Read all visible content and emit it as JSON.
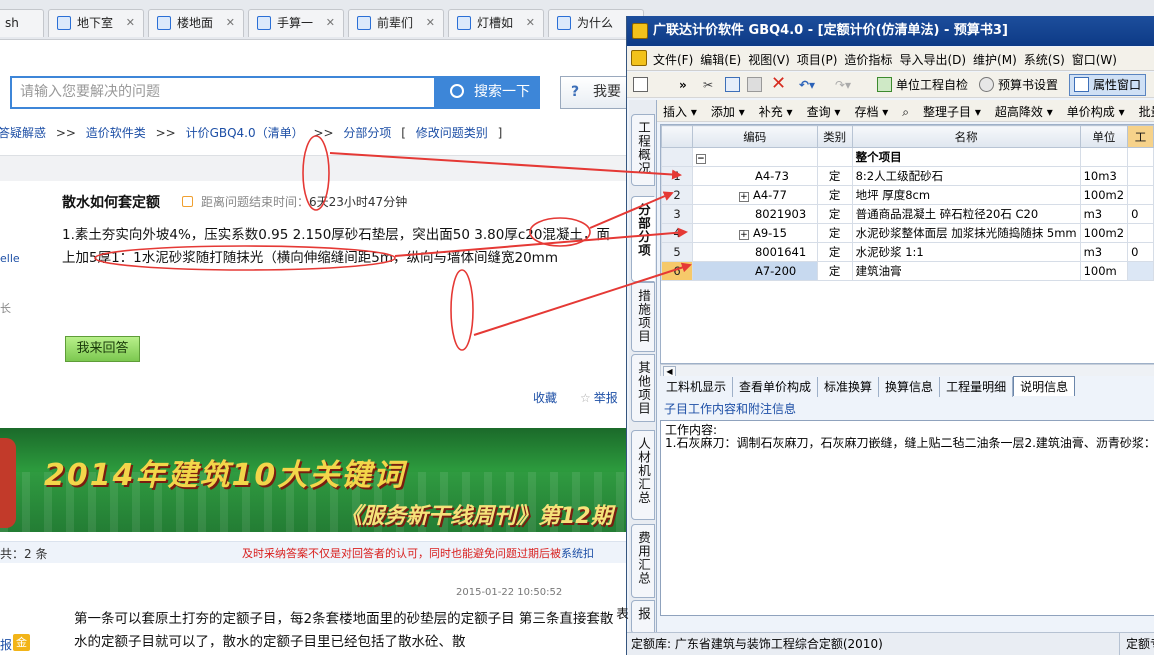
{
  "browser": {
    "tabs": [
      {
        "title": "sh"
      },
      {
        "title": "地下室"
      },
      {
        "title": "楼地面"
      },
      {
        "title": "手算一"
      },
      {
        "title": "前辈们"
      },
      {
        "title": "灯槽如"
      },
      {
        "title": "为什么"
      }
    ]
  },
  "search": {
    "placeholder": "请输入您要解决的问题",
    "button": "搜索一下",
    "ask": "我要"
  },
  "breadcrumb": {
    "items": [
      "答疑解惑",
      "造价软件类",
      "计价GBQ4.0（清单）",
      "分部分项"
    ],
    "separator": ">>",
    "edit": "修改问题类别"
  },
  "question": {
    "title": "散水如何套定额",
    "timer_label": "距离问题结束时间：",
    "timer_value": "6天23小时47分钟",
    "body": "1.素土夯实向外坡4%，压实系数0.95 2.150厚砂石垫层，突出面50 3.80厚c20混凝土，面上加5厚1：1水泥砂浆随打随抹光（横向伸缩缝间距5m，纵向与墙体间缝宽20mm",
    "side_user": "elle",
    "side_level": "长",
    "answer_button": "我来回答",
    "collect": "收藏",
    "report": "举报"
  },
  "banner": {
    "line1": "2014年建筑10大关键词",
    "line2": "《服务新干线周刊》第12期"
  },
  "answers": {
    "count_label": "共：2 条",
    "tip": "及时采纳答案不仅是对回答者的认可，同时也能避免问题过期后被",
    "tip_link": "系统扣",
    "date": "2015-01-22 10:50:52",
    "body": "第一条可以套原土打夯的定额子目，每2条套楼地面里的砂垫层的定额子目 第三条直接套散水的定额子目就可以了，散水的定额子目里已经包括了散水砼、散",
    "reply": "报",
    "badge": "金"
  },
  "app": {
    "title": "广联达计价软件 GBQ4.0 - [定额计价(仿清单法) - 预算书3]",
    "menu": [
      "文件(F)",
      "编辑(E)",
      "视图(V)",
      "项目(P)",
      "造价指标",
      "导入导出(D)",
      "维护(M)",
      "系统(S)",
      "窗口(W)"
    ],
    "toolbar": {
      "check": "单位工程自检",
      "settings": "预算书设置",
      "props": "属性窗口"
    },
    "toolbar2": [
      "插入",
      "添加",
      "补充",
      "查询",
      "存档",
      "整理子目",
      "超高降效",
      "单价构成",
      "批量"
    ],
    "vtabs": [
      "工程概况",
      "分部分项",
      "措施项目",
      "其他项目",
      "人材机汇总",
      "费用汇总",
      "报表"
    ],
    "grid": {
      "headers": [
        "",
        "编码",
        "类别",
        "名称",
        "单位",
        "工"
      ],
      "rows": [
        {
          "num": "",
          "code": "",
          "type": "",
          "name": "整个项目",
          "unit": "",
          "extra": "",
          "expander": "−"
        },
        {
          "num": "1",
          "code": "A4-73",
          "type": "定",
          "name": "8:2人工级配砂石",
          "unit": "10m3",
          "extra": "",
          "expander": ""
        },
        {
          "num": "2",
          "code": "A4-77",
          "type": "定",
          "name": "地坪 厚度8cm",
          "unit": "100m2",
          "extra": "",
          "expander": "+"
        },
        {
          "num": "3",
          "code": "8021903",
          "type": "定",
          "name": "普通商品混凝土 碎石粒径20石 C20",
          "unit": "m3",
          "extra": "0",
          "expander": ""
        },
        {
          "num": "4",
          "code": "A9-15",
          "type": "定",
          "name": "水泥砂浆整体面层 加浆抹光随捣随抹 5mm",
          "unit": "100m2",
          "extra": "",
          "expander": "+"
        },
        {
          "num": "5",
          "code": "8001641",
          "type": "定",
          "name": "水泥砂浆 1:1",
          "unit": "m3",
          "extra": "0",
          "expander": ""
        },
        {
          "num": "6",
          "code": "A7-200",
          "type": "定",
          "name": "建筑油膏",
          "unit": "100m",
          "extra": "",
          "expander": ""
        }
      ]
    },
    "bottom_tabs": [
      "工料机显示",
      "查看单价构成",
      "标准换算",
      "换算信息",
      "工程量明细",
      "说明信息"
    ],
    "bottom_active": "说明信息",
    "subhead": "子目工作内容和附注信息",
    "work_label": "工作内容:",
    "work_text": "1.石灰麻刀：调制石灰麻刀，石灰麻刀嵌缝，缝上贴二毡二油条一层2.建筑油膏、沥青砂浆：",
    "status": "定额库: 广东省建筑与装饰工程综合定额(2010)",
    "status_right": "定额专"
  },
  "colors": {
    "annotation": "#e53935",
    "accent": "#3d86d8",
    "title_bar": "#0d3a86"
  }
}
